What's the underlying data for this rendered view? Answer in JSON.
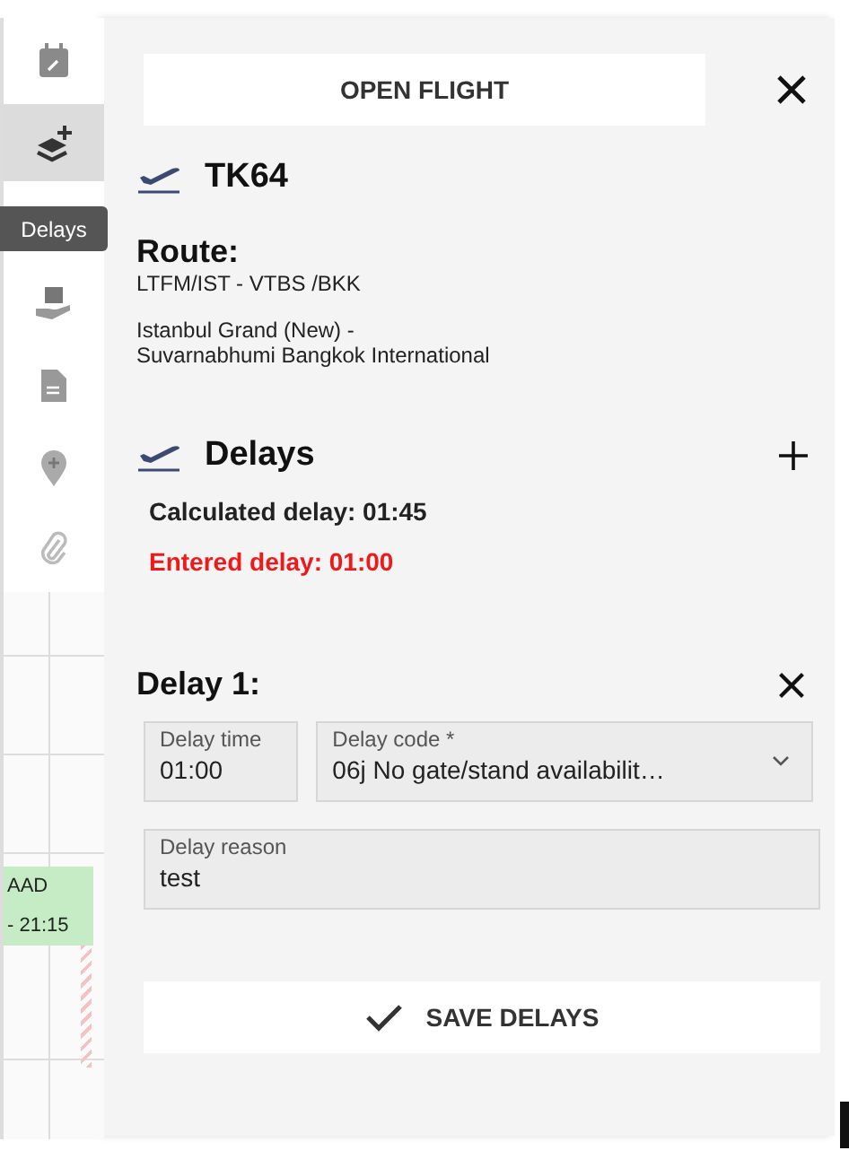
{
  "sidebar": {
    "items": [
      {
        "kind": "calendar",
        "selected": false
      },
      {
        "kind": "layers",
        "selected": true
      },
      {
        "kind": "save",
        "selected": false
      },
      {
        "kind": "document",
        "selected": false
      },
      {
        "kind": "pin",
        "selected": false
      },
      {
        "kind": "attachment",
        "selected": false
      }
    ],
    "tooltip": "Delays"
  },
  "timeline": {
    "events": [
      {
        "lines": [
          "AAD",
          "- 21:15"
        ]
      }
    ]
  },
  "panel": {
    "open_button": "OPEN FLIGHT",
    "flight": "TK64",
    "route_label": "Route:",
    "route_codes": "LTFM/IST - VTBS /BKK",
    "route_names": [
      "Istanbul Grand (New) -",
      "Suvarnabhumi Bangkok International"
    ],
    "delays_title": "Delays",
    "summary": [
      {
        "text": "Calculated delay: 01:45",
        "kind": "normal"
      },
      {
        "text": "Entered delay: 01:00",
        "kind": "alert"
      }
    ],
    "delay_items": [
      {
        "title": "Delay 1:",
        "fields": [
          {
            "kind": "text",
            "label": "Delay time",
            "value": "01:00"
          },
          {
            "kind": "select",
            "label": "Delay code *",
            "value": "06j No gate/stand availabilit…"
          }
        ],
        "reason": {
          "label": "Delay reason",
          "value": "test"
        }
      }
    ],
    "save_button": "SAVE DELAYS"
  }
}
